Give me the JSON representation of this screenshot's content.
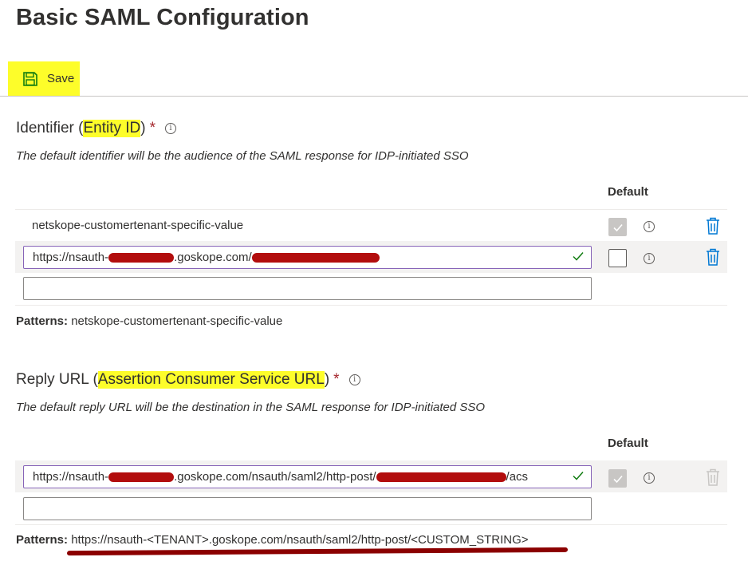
{
  "page": {
    "title": "Basic SAML Configuration"
  },
  "toolbar": {
    "save_label": "Save"
  },
  "identifier": {
    "title_prefix": "Identifier (",
    "title_highlight": "Entity ID",
    "title_suffix": ")",
    "required": "*",
    "description": "The default identifier will be the audience of the SAML response for IDP-initiated SSO",
    "default_header": "Default",
    "rows": [
      {
        "value": "netskope-customertenant-specific-value"
      },
      {
        "value_start": "https://nsauth-",
        "value_mid": ".goskope.com/",
        "value_end": ""
      },
      {
        "value": ""
      }
    ],
    "patterns_label": "Patterns:",
    "patterns_value": "netskope-customertenant-specific-value"
  },
  "reply": {
    "title_prefix": "Reply URL (",
    "title_highlight": "Assertion Consumer Service URL",
    "title_suffix": ")",
    "required": "*",
    "description": "The default reply URL will be the destination in the SAML response for IDP-initiated SSO",
    "default_header": "Default",
    "rows": [
      {
        "value_start": "https://nsauth-",
        "value_mid": ".goskope.com/nsauth/saml2/http-post/",
        "value_end": "/acs"
      },
      {
        "value": ""
      }
    ],
    "patterns_label": "Patterns:",
    "patterns_value": "https://nsauth-<TENANT>.goskope.com/nsauth/saml2/http-post/<CUSTOM_STRING>"
  },
  "colors": {
    "highlight": "#fdfd2a",
    "trash_blue": "#0078d4",
    "redaction": "#b20d0d",
    "focus_border": "#8764b8"
  }
}
